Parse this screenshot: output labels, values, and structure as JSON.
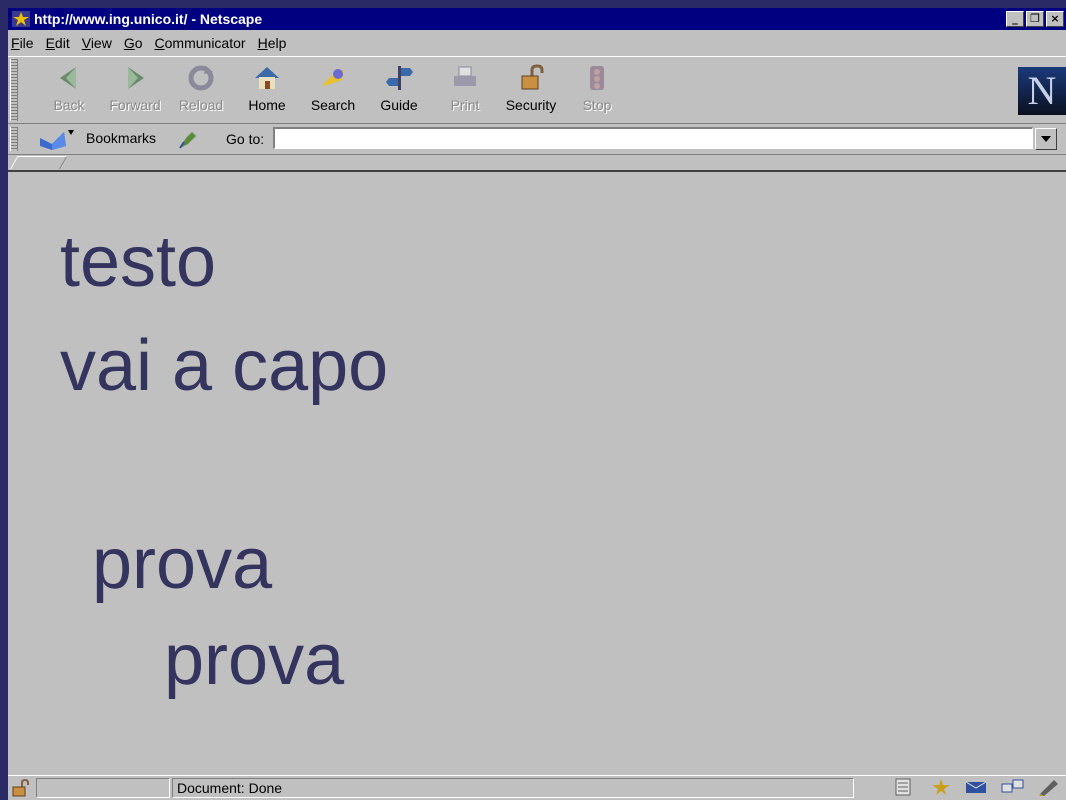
{
  "window": {
    "title": "http://www.ing.unico.it/ - Netscape",
    "minimize": "_",
    "restore": "❐",
    "close": "×"
  },
  "menu": [
    {
      "key": "F",
      "rest": "ile"
    },
    {
      "key": "E",
      "rest": "dit"
    },
    {
      "key": "V",
      "rest": "iew"
    },
    {
      "key": "G",
      "rest": "o"
    },
    {
      "key": "C",
      "rest": "ommunicator"
    },
    {
      "key": "H",
      "rest": "elp"
    }
  ],
  "toolbar": {
    "back": "Back",
    "forward": "Forward",
    "reload": "Reload",
    "home": "Home",
    "search": "Search",
    "guide": "Guide",
    "print": "Print",
    "security": "Security",
    "stop": "Stop",
    "logo": "N"
  },
  "location": {
    "bookmarks": "Bookmarks",
    "goto_label": "Go to:",
    "url": ""
  },
  "content": {
    "line1": "testo",
    "line2": "vai a capo",
    "line3": "prova",
    "line4": "prova"
  },
  "status": {
    "text": "Document: Done"
  },
  "colors": {
    "desktop": "#2a2a66",
    "titlebar": "#000080",
    "chrome": "#c0c0c0",
    "content_text": "#34345e"
  }
}
